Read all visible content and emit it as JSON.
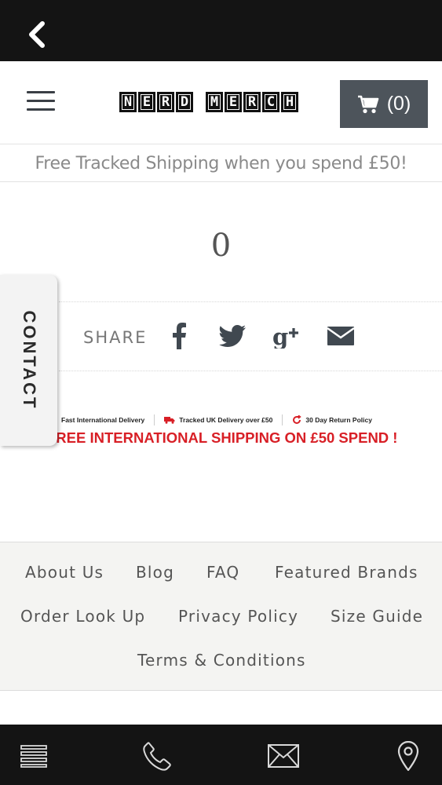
{
  "topbar": {
    "back_icon": "chevron-left-icon"
  },
  "header": {
    "menu_icon": "hamburger-menu-icon",
    "logo_word1": [
      "N",
      "E",
      "R",
      "D"
    ],
    "logo_word2": [
      "M",
      "E",
      "R",
      "C",
      "H"
    ],
    "logo_text": "NERD MERCH",
    "cart_icon": "cart-icon",
    "cart_count": "(0)"
  },
  "promo": {
    "text": "Free Tracked Shipping when you spend £50!"
  },
  "content": {
    "zero_value": "0"
  },
  "share": {
    "label": "SHARE",
    "icons": [
      "facebook-icon",
      "twitter-icon",
      "google-plus-icon",
      "email-icon"
    ]
  },
  "contact_tab": {
    "label": "CONTACT"
  },
  "banner": {
    "feature_1": "Fast International Delivery",
    "feature_2": "Tracked UK Delivery over £50",
    "feature_3": "30 Day Return Policy",
    "headline": "FREE INTERNATIONAL SHIPPING ON £50 SPEND !",
    "accent_color": "#d81f26"
  },
  "footer": {
    "about": "About Us",
    "blog": "Blog",
    "faq": "FAQ",
    "brands": "Featured Brands",
    "order_lookup": "Order Look Up",
    "privacy": "Privacy Policy",
    "size_guide": "Size Guide",
    "terms": "Terms & Conditions"
  },
  "bottombar": {
    "icons": [
      "list-icon",
      "phone-icon",
      "mail-icon",
      "location-pin-icon"
    ]
  },
  "colors": {
    "bar_bg": "#141414",
    "cart_bg": "#4d545b",
    "footer_bg": "#f4f4f2"
  }
}
